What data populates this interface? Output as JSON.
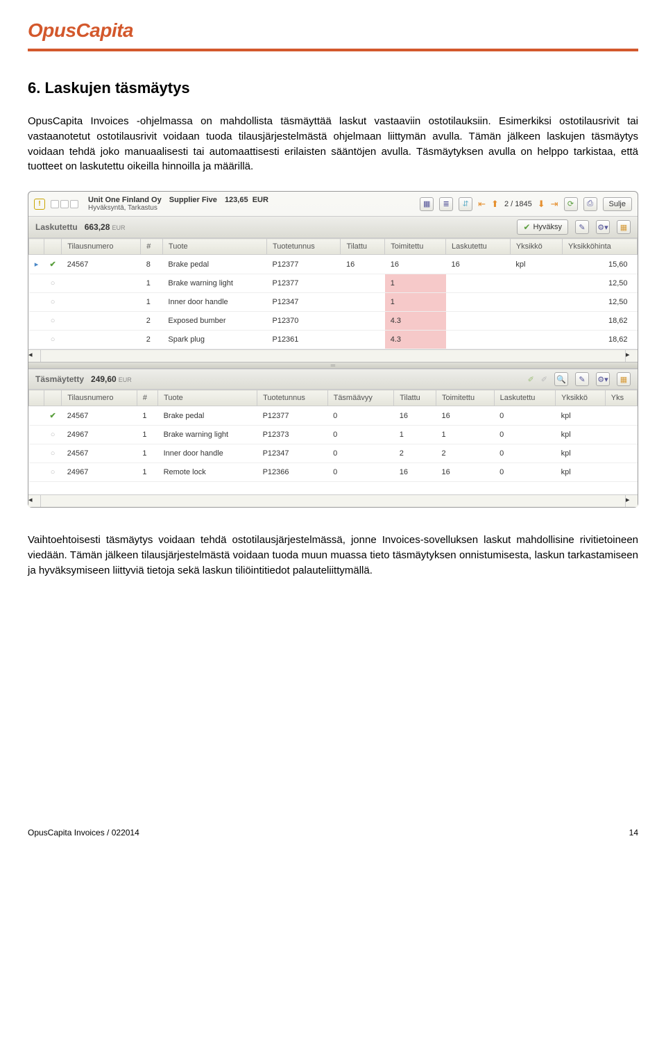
{
  "logo": "OpusCapita",
  "heading": "6. Laskujen täsmäytys",
  "para1": "OpusCapita Invoices -ohjelmassa on mahdollista täsmäyttää laskut vastaaviin ostotilauksiin. Esimerkiksi ostotilausrivit tai vastaanotetut ostotilausrivit voidaan tuoda tilausjärjestelmästä ohjelmaan liittymän avulla. Tämän jälkeen laskujen täsmäytys voidaan tehdä joko manuaalisesti tai automaattisesti erilaisten sääntöjen avulla. Täsmäytyksen avulla on helppo tarkistaa, että tuotteet on laskutettu oikeilla hinnoilla ja määrillä.",
  "para2": "Vaihtoehtoisesti täsmäytys voidaan tehdä ostotilausjärjestelmässä, jonne Invoices-sovelluksen laskut mahdollisine rivitietoineen viedään. Tämän jälkeen tilausjärjestelmästä voidaan tuoda muun muassa tieto täsmäytyksen onnistumisesta, laskun tarkastamiseen ja hyväksymiseen liittyviä tietoja sekä laskun tiliöintitiedot palauteliittymällä.",
  "header": {
    "company": "Unit One Finland Oy",
    "supplier": "Supplier Five",
    "amount": "123,65",
    "currency": "EUR",
    "status": "Hyväksyntä, Tarkastus",
    "nav": "2 / 1845",
    "close": "Sulje"
  },
  "sec1": {
    "label": "Laskutettu",
    "amount": "663,28",
    "cur": "EUR",
    "approve": "Hyväksy",
    "cols": [
      "",
      "",
      "Tilausnumero",
      "#",
      "Tuote",
      "Tuotetunnus",
      "Tilattu",
      "Toimitettu",
      "Laskutettu",
      "Yksikkö",
      "Yksikköhinta"
    ],
    "rows": [
      {
        "mark": "▸",
        "chk": "✓",
        "tn": "24567",
        "n": "8",
        "tuote": "Brake pedal",
        "kood": "P12377",
        "til": "16",
        "toi": "16",
        "las": "16",
        "yks": "kpl",
        "hinta": "15,60",
        "hl": false
      },
      {
        "mark": "",
        "chk": "○",
        "tn": "",
        "n": "1",
        "tuote": "Brake warning light",
        "kood": "P12377",
        "til": "",
        "toi": "1",
        "las": "",
        "yks": "",
        "hinta": "12,50",
        "hl": true
      },
      {
        "mark": "",
        "chk": "○",
        "tn": "",
        "n": "1",
        "tuote": "Inner door handle",
        "kood": "P12347",
        "til": "",
        "toi": "1",
        "las": "",
        "yks": "",
        "hinta": "12,50",
        "hl": true
      },
      {
        "mark": "",
        "chk": "○",
        "tn": "",
        "n": "2",
        "tuote": "Exposed bumber",
        "kood": "P12370",
        "til": "",
        "toi": "4.3",
        "las": "",
        "yks": "",
        "hinta": "18,62",
        "hl": true
      },
      {
        "mark": "",
        "chk": "○",
        "tn": "",
        "n": "2",
        "tuote": "Spark plug",
        "kood": "P12361",
        "til": "",
        "toi": "4.3",
        "las": "",
        "yks": "",
        "hinta": "18,62",
        "hl": true
      }
    ]
  },
  "sec2": {
    "label": "Täsmäytetty",
    "amount": "249,60",
    "cur": "EUR",
    "cols": [
      "",
      "",
      "Tilausnumero",
      "#",
      "Tuote",
      "Tuotetunnus",
      "Täsmäävyy",
      "Tilattu",
      "Toimitettu",
      "Laskutettu",
      "Yksikkö",
      "Yks"
    ],
    "rows": [
      {
        "chk": "✓",
        "tn": "24567",
        "n": "1",
        "tuote": "Brake pedal",
        "kood": "P12377",
        "tas": "0",
        "til": "16",
        "toi": "16",
        "las": "0",
        "yks": "kpl"
      },
      {
        "chk": "○",
        "tn": "24967",
        "n": "1",
        "tuote": "Brake warning light",
        "kood": "P12373",
        "tas": "0",
        "til": "1",
        "toi": "1",
        "las": "0",
        "yks": "kpl"
      },
      {
        "chk": "○",
        "tn": "24567",
        "n": "1",
        "tuote": "Inner door handle",
        "kood": "P12347",
        "tas": "0",
        "til": "2",
        "toi": "2",
        "las": "0",
        "yks": "kpl"
      },
      {
        "chk": "○",
        "tn": "24967",
        "n": "1",
        "tuote": "Remote lock",
        "kood": "P12366",
        "tas": "0",
        "til": "16",
        "toi": "16",
        "las": "0",
        "yks": "kpl"
      }
    ]
  },
  "footer": {
    "left": "OpusCapita Invoices / 022014",
    "right": "14"
  }
}
